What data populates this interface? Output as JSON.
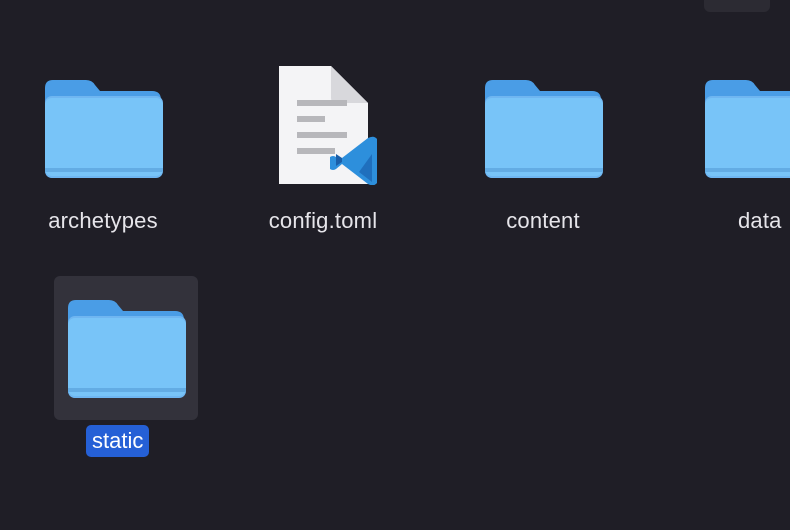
{
  "window": {
    "accent_color": "#2560d6",
    "background_color": "#1f1e26"
  },
  "files": [
    {
      "name": "archetypes",
      "kind": "folder",
      "icon": "folder-icon"
    },
    {
      "name": "config.toml",
      "kind": "document",
      "icon": "vscode-document-icon"
    },
    {
      "name": "content",
      "kind": "folder",
      "icon": "folder-icon"
    },
    {
      "name": "data",
      "kind": "folder",
      "icon": "folder-icon"
    },
    {
      "name": "static",
      "kind": "folder",
      "icon": "folder-icon",
      "selected": true
    }
  ]
}
